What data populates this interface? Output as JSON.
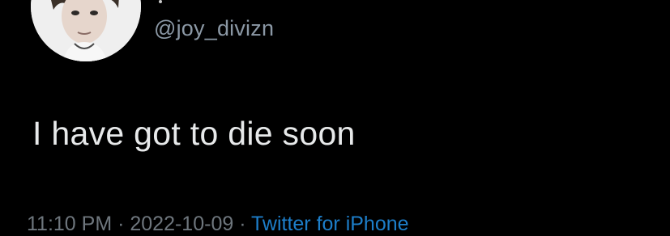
{
  "tweet": {
    "handle": "@joy_divizn",
    "text": "I have got to die soon",
    "timestamp": "11:10 PM · 2022-10-09 · ",
    "source": "Twitter for iPhone"
  },
  "colors": {
    "background": "#000000",
    "text": "#e7e9ea",
    "secondary_text": "#8b98a5",
    "link": "#1d7ec9"
  }
}
